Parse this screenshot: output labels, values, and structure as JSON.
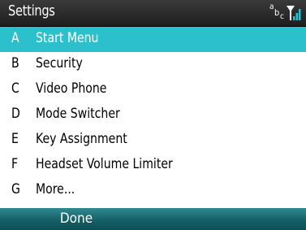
{
  "titlebar": {
    "title": "Settings",
    "input_mode": {
      "a": "a",
      "b": "b",
      "c": "c"
    },
    "signal_icon": "signal-strength-icon"
  },
  "menu": {
    "items": [
      {
        "key": "A",
        "label": "Start Menu",
        "selected": true
      },
      {
        "key": "B",
        "label": "Security",
        "selected": false
      },
      {
        "key": "C",
        "label": "Video Phone",
        "selected": false
      },
      {
        "key": "D",
        "label": "Mode Switcher",
        "selected": false
      },
      {
        "key": "E",
        "label": "Key Assignment",
        "selected": false
      },
      {
        "key": "F",
        "label": "Headset Volume Limiter",
        "selected": false
      },
      {
        "key": "G",
        "label": "More...",
        "selected": false
      }
    ]
  },
  "softkeys": {
    "left": "Done",
    "right": ""
  },
  "colors": {
    "selection": "#2cc0cc",
    "titlebar": "#2a2a2a",
    "softkey_bar": "#156066"
  }
}
